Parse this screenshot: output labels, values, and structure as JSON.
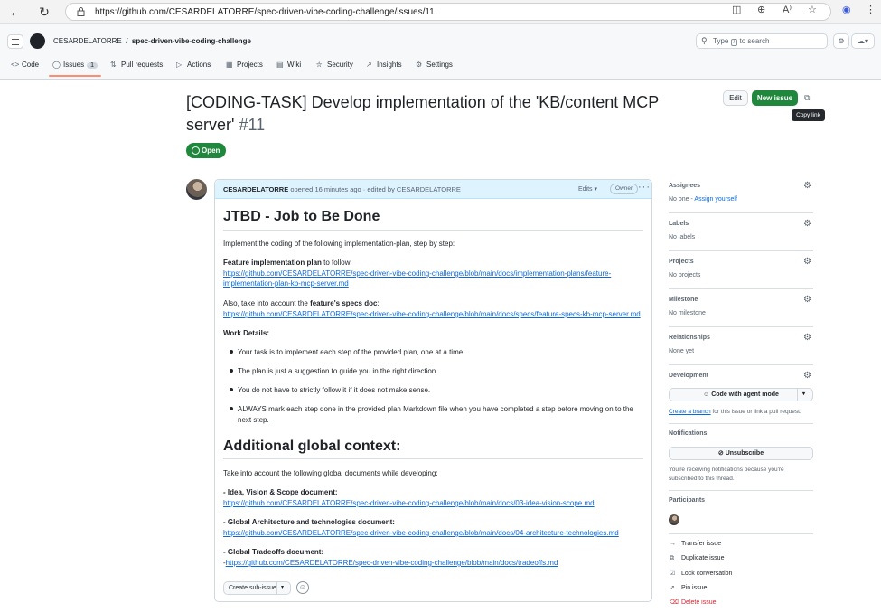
{
  "browser": {
    "url": "https://github.com/CESARDELATORRE/spec-driven-vibe-coding-challenge/issues/11"
  },
  "header": {
    "owner": "CESARDELATORRE",
    "separator": "/",
    "repo": "spec-driven-vibe-coding-challenge",
    "search_prefix": "Type",
    "search_key": "/",
    "search_suffix": "to search"
  },
  "tabs": [
    {
      "label": "Code",
      "icon": "code-icon"
    },
    {
      "label": "Issues",
      "icon": "issue-icon",
      "count": "1"
    },
    {
      "label": "Pull requests",
      "icon": "pull-request-icon"
    },
    {
      "label": "Actions",
      "icon": "play-icon"
    },
    {
      "label": "Projects",
      "icon": "table-icon"
    },
    {
      "label": "Wiki",
      "icon": "book-icon"
    },
    {
      "label": "Security",
      "icon": "shield-icon"
    },
    {
      "label": "Insights",
      "icon": "graph-icon"
    },
    {
      "label": "Settings",
      "icon": "gear-icon"
    }
  ],
  "issue": {
    "title": "[CODING-TASK] Develop implementation of the 'KB/content MCP server'",
    "number": "#11",
    "state": "Open",
    "edit_label": "Edit",
    "new_issue_label": "New issue",
    "copy_link_tooltip": "Copy link"
  },
  "comment": {
    "author": "CESARDELATORRE",
    "meta": "opened 16 minutes ago · edited by CESARDELATORRE",
    "edits_label": "Edits",
    "owner_label": "Owner",
    "heading1": "JTBD - Job to Be Done",
    "intro": "Implement the coding of the following implementation-plan, step by step:",
    "feature_plan_bold": "Feature implementation plan",
    "feature_plan_rest": " to follow:",
    "feature_plan_link_1": "https://github.com/CESARDELATORRE/spec-driven-vibe-coding-challenge/blob/main/docs/implementation-plans/feature-",
    "feature_plan_link_2": "implementation-plan-kb-mcp-server.md",
    "specs_pre": "Also, take into account the ",
    "specs_bold": "feature's specs doc",
    "specs_post": ":",
    "specs_link": "https://github.com/CESARDELATORRE/spec-driven-vibe-coding-challenge/blob/main/docs/specs/feature-specs-kb-mcp-server.md",
    "work_details": "Work Details:",
    "bullets": [
      "Your task is to implement each step of the provided plan, one at a time.",
      "The plan is just a suggestion to guide you in the right direction.",
      "You do not have to strictly follow it if it does not make sense.",
      "ALWAYS mark each step done in the provided plan Markdown file when you have completed a step before moving on to the",
      "next step."
    ],
    "heading2": "Additional global context:",
    "context_intro": "Take into account the following global documents while developing:",
    "doc1_label": "- Idea, Vision & Scope document:",
    "doc1_link": "https://github.com/CESARDELATORRE/spec-driven-vibe-coding-challenge/blob/main/docs/03-idea-vision-scope.md",
    "doc2_label": "- Global Architecture and technologies document:",
    "doc2_link": "https://github.com/CESARDELATORRE/spec-driven-vibe-coding-challenge/blob/main/docs/04-architecture-technologies.md",
    "doc3_label": "- Global Tradeoffs document:",
    "doc3_dash": "-",
    "doc3_link": "https://github.com/CESARDELATORRE/spec-driven-vibe-coding-challenge/blob/main/docs/tradeoffs.md",
    "create_subissue": "Create sub-issue"
  },
  "sidebar": {
    "assignees_title": "Assignees",
    "assignees_value": "No one -",
    "assign_yourself": "Assign yourself",
    "labels_title": "Labels",
    "labels_value": "No labels",
    "projects_title": "Projects",
    "projects_value": "No projects",
    "milestone_title": "Milestone",
    "milestone_value": "No milestone",
    "relationships_title": "Relationships",
    "relationships_value": "None yet",
    "development_title": "Development",
    "agent_button": "Code with agent mode",
    "create_branch_link": "Create a branch",
    "create_branch_rest": " for this issue or link a pull request.",
    "notifications_title": "Notifications",
    "unsubscribe_label": "Unsubscribe",
    "notif_text_1": "You're receiving notifications because you're",
    "notif_text_2": "subscribed to this thread.",
    "participants_title": "Participants",
    "actions": [
      {
        "label": "Transfer issue",
        "icon": "arrow-right-icon"
      },
      {
        "label": "Duplicate issue",
        "icon": "duplicate-icon"
      },
      {
        "label": "Lock conversation",
        "icon": "lock-icon"
      },
      {
        "label": "Pin issue",
        "icon": "pin-icon"
      },
      {
        "label": "Delete issue",
        "icon": "trash-icon"
      }
    ]
  }
}
